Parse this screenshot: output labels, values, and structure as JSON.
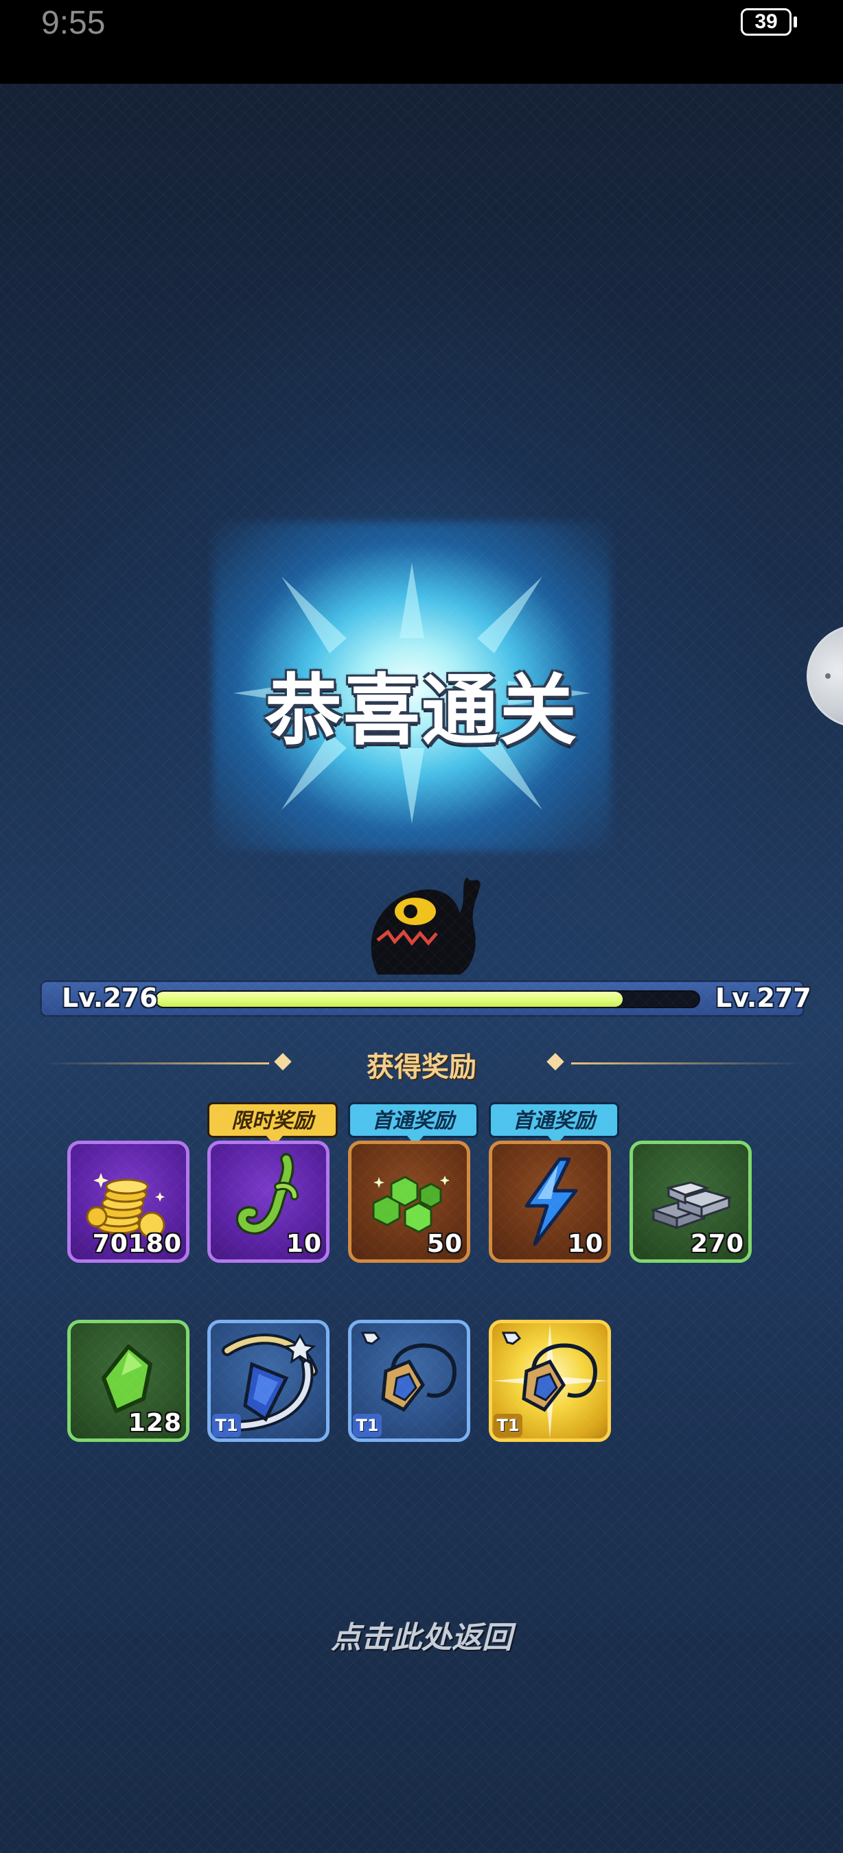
{
  "status_bar": {
    "time": "9:55",
    "battery": "39"
  },
  "result": {
    "title": "恭喜通关"
  },
  "level": {
    "current": "Lv.276",
    "next": "Lv.277",
    "progress": 0.86
  },
  "rewards_header": "获得奖励",
  "reward_tags": {
    "limited": "限时奖励",
    "first_clear": "首通奖励"
  },
  "rewards_row1": [
    {
      "icon": "gold-coins-icon",
      "quantity": "70180",
      "rarity": "purple"
    },
    {
      "icon": "green-vine-icon",
      "quantity": "10",
      "rarity": "purple",
      "tag": "限时奖励"
    },
    {
      "icon": "green-gems-icon",
      "quantity": "50",
      "rarity": "orange",
      "tag": "首通奖励"
    },
    {
      "icon": "blue-lightning-icon",
      "quantity": "10",
      "rarity": "orange",
      "tag": "首通奖励"
    },
    {
      "icon": "silver-ingots-icon",
      "quantity": "270",
      "rarity": "green"
    }
  ],
  "rewards_row2": [
    {
      "icon": "green-crystal-icon",
      "quantity": "128",
      "rarity": "green"
    },
    {
      "icon": "crossbow-weapon-icon",
      "tier": "T1",
      "rarity": "blue"
    },
    {
      "icon": "amulet-necklace-icon",
      "tier": "T1",
      "rarity": "blue"
    },
    {
      "icon": "amulet-necklace-icon",
      "tier": "T1",
      "rarity": "gold"
    }
  ],
  "return_hint": "点击此处返回"
}
